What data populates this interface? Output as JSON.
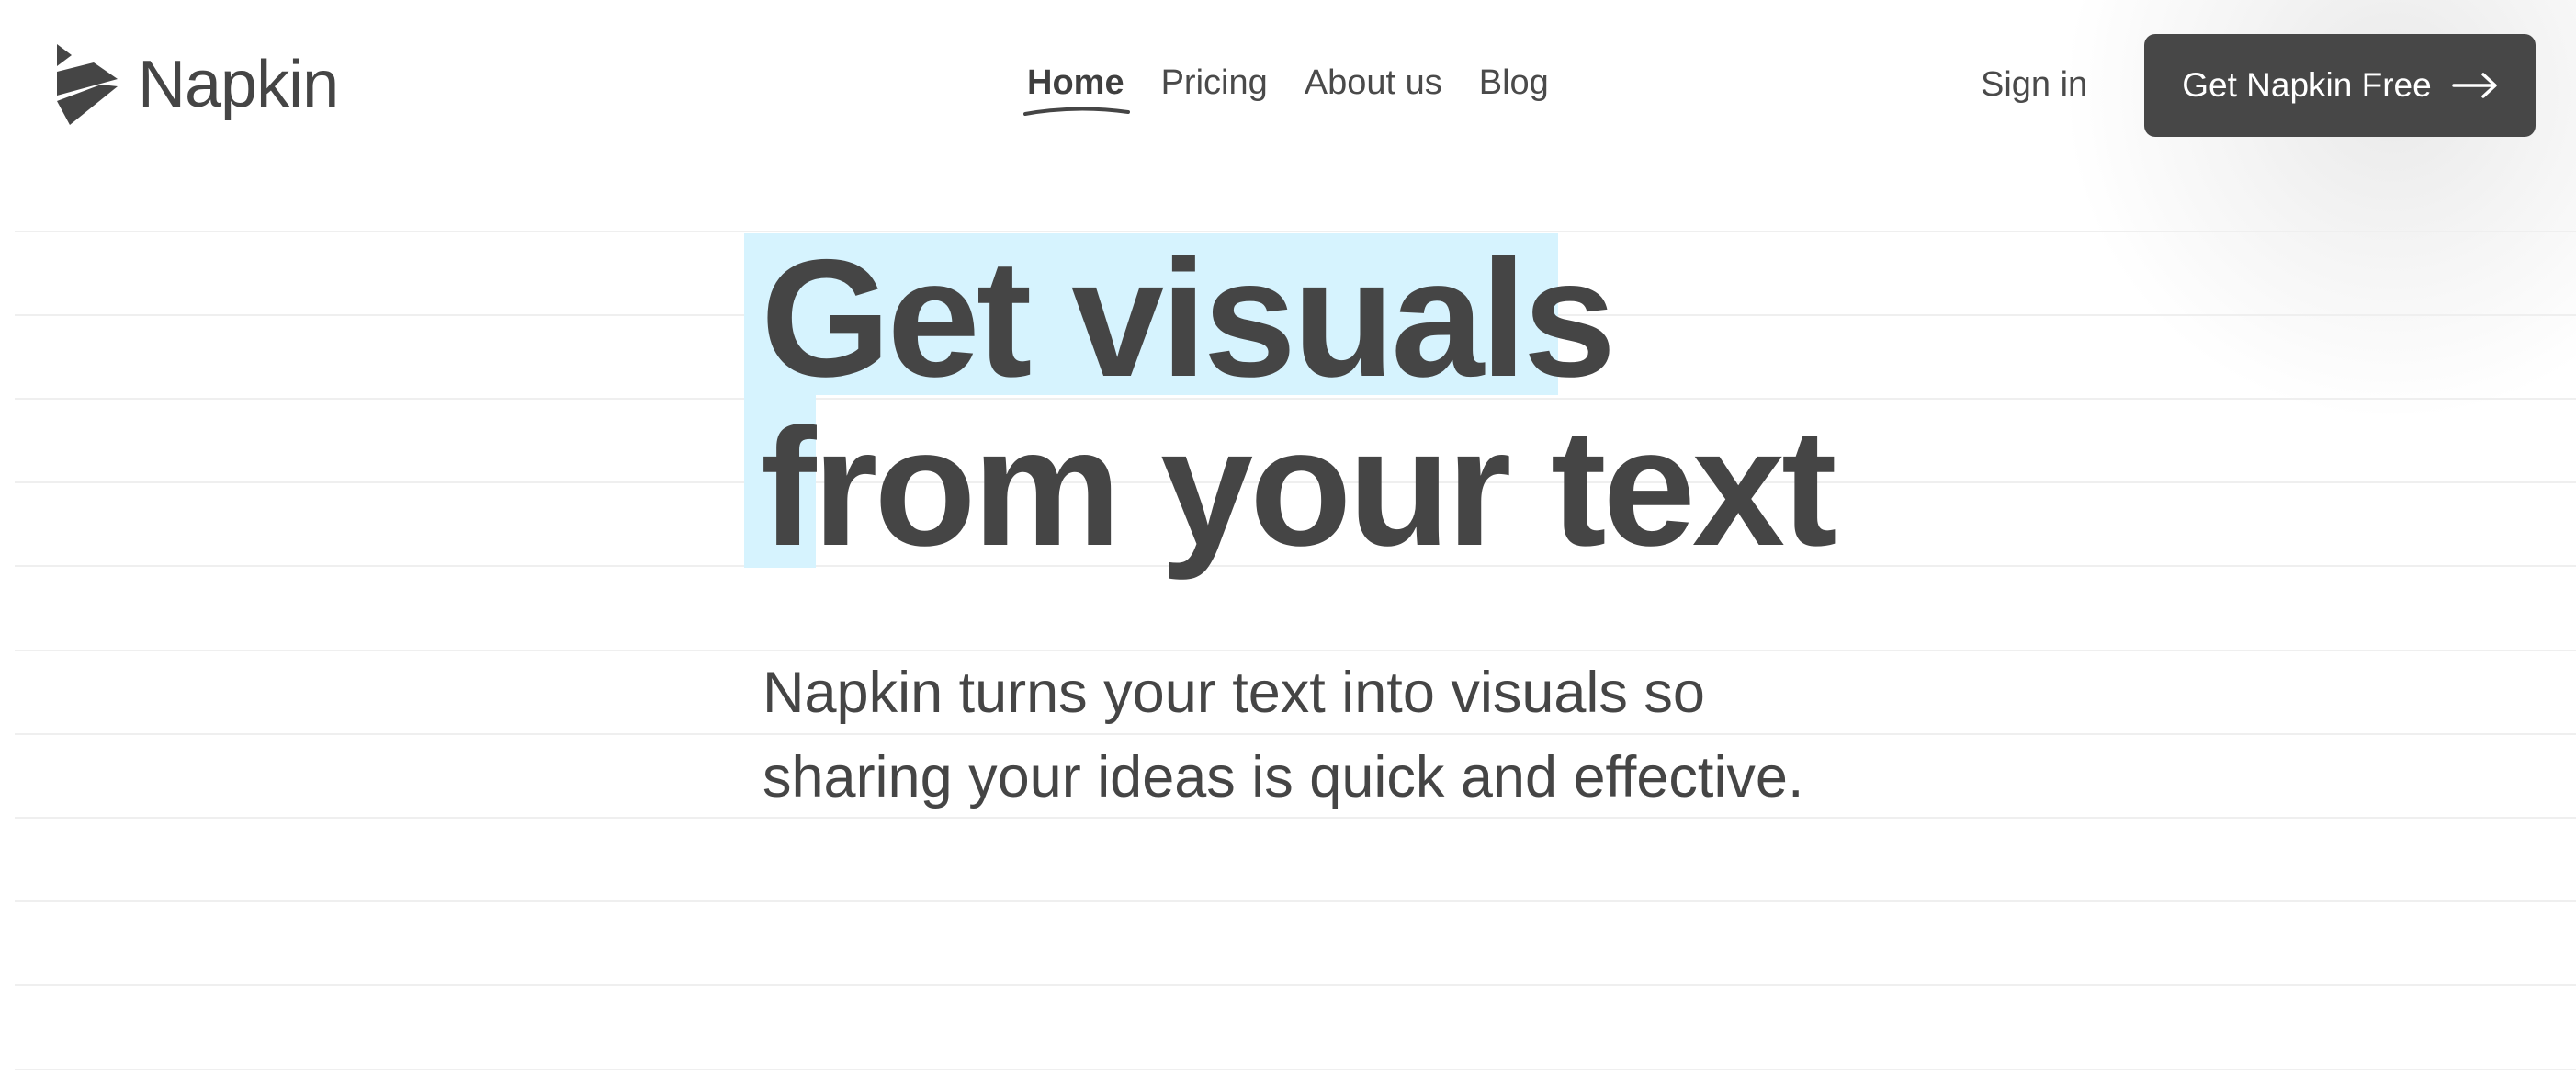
{
  "header": {
    "logo_text": "Napkin",
    "nav": [
      {
        "label": "Home",
        "active": true
      },
      {
        "label": "Pricing",
        "active": false
      },
      {
        "label": "About us",
        "active": false
      },
      {
        "label": "Blog",
        "active": false
      }
    ],
    "sign_in_label": "Sign in",
    "cta_label": "Get Napkin Free"
  },
  "hero": {
    "title_line1": "Get visuals",
    "title_line2": "from your text",
    "subtitle": "Napkin turns your text into visuals so sharing your ideas is quick and effective."
  },
  "icons": {
    "logo": "napkin-logo-icon",
    "cta_arrow": "arrow-right-icon"
  },
  "colors": {
    "text": "#454545",
    "button_bg": "#474747",
    "highlight": "#d6f3fe",
    "rule_line": "#efefef"
  }
}
